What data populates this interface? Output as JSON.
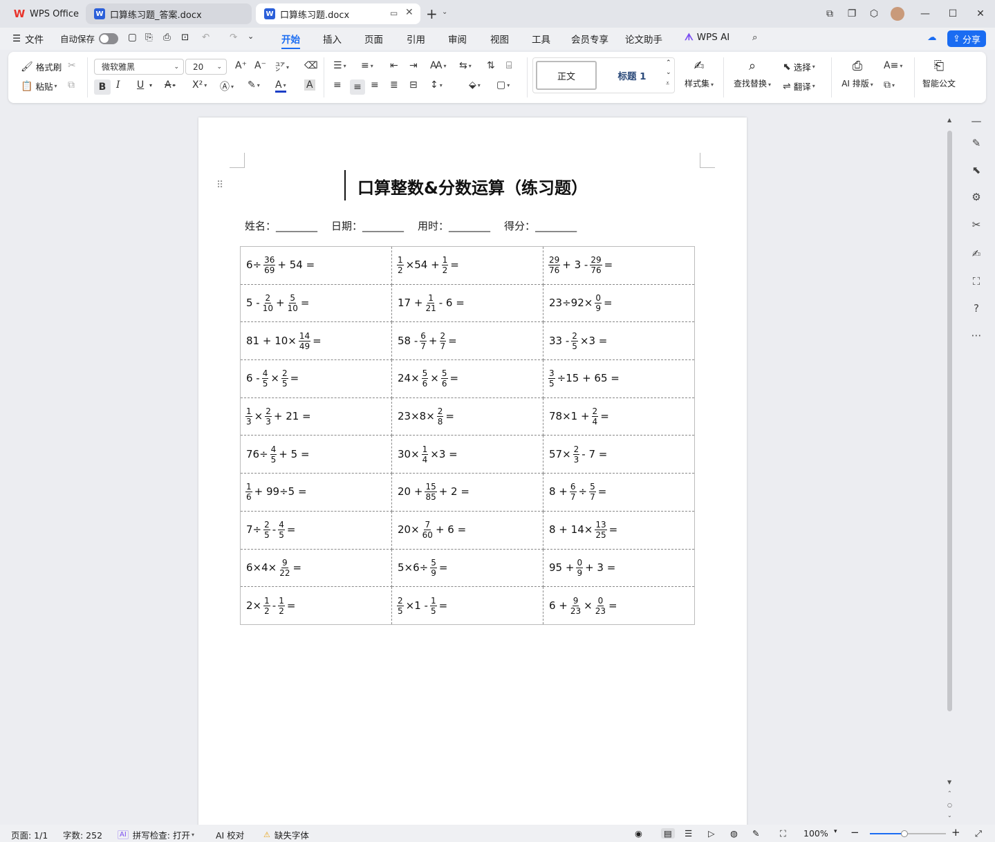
{
  "tabs": [
    {
      "label": "WPS Office"
    },
    {
      "label": "口算练习题_答案.docx"
    },
    {
      "label": "口算练习题.docx"
    }
  ],
  "menu": {
    "file": "文件",
    "autosave": "自动保存",
    "items": [
      "开始",
      "插入",
      "页面",
      "引用",
      "审阅",
      "视图",
      "工具",
      "会员专享",
      "论文助手",
      "WPS AI"
    ],
    "share": "分享"
  },
  "ribbon": {
    "format_painter": "格式刷",
    "paste": "粘贴",
    "font_name": "微软雅黑",
    "font_size": "20",
    "style_normal": "正文",
    "style_heading": "标题 1",
    "style_set": "样式集",
    "find_replace": "查找替换",
    "select": "选择",
    "translate": "翻译",
    "ai_layout": "AI 排版",
    "smart_doc": "智能公文",
    "bold": "B",
    "italic": "I",
    "underline": "U"
  },
  "document": {
    "title": "口算整数&分数运算（练习题）",
    "info": [
      {
        "label": "姓名：",
        "blank": "________"
      },
      {
        "label": "日期：",
        "blank": "________"
      },
      {
        "label": "用时：",
        "blank": "________"
      },
      {
        "label": "得分：",
        "blank": "________"
      }
    ],
    "problems": [
      [
        [
          {
            "t": "6÷"
          },
          {
            "n": "36",
            "d": "69"
          },
          {
            "t": "+ 54 ="
          }
        ],
        [
          {
            "n": "1",
            "d": "2"
          },
          {
            "t": "×54 +"
          },
          {
            "n": "1",
            "d": "2"
          },
          {
            "t": "="
          }
        ],
        [
          {
            "n": "29",
            "d": "76"
          },
          {
            "t": "+ 3 -"
          },
          {
            "n": "29",
            "d": "76"
          },
          {
            "t": "="
          }
        ]
      ],
      [
        [
          {
            "t": "5 -"
          },
          {
            "n": "2",
            "d": "10"
          },
          {
            "t": "+"
          },
          {
            "n": "5",
            "d": "10"
          },
          {
            "t": "="
          }
        ],
        [
          {
            "t": "17 +"
          },
          {
            "n": "1",
            "d": "21"
          },
          {
            "t": "- 6 ="
          }
        ],
        [
          {
            "t": "23÷92×"
          },
          {
            "n": "0",
            "d": "9"
          },
          {
            "t": "="
          }
        ]
      ],
      [
        [
          {
            "t": "81 + 10×"
          },
          {
            "n": "14",
            "d": "49"
          },
          {
            "t": "="
          }
        ],
        [
          {
            "t": "58 -"
          },
          {
            "n": "6",
            "d": "7"
          },
          {
            "t": "+"
          },
          {
            "n": "2",
            "d": "7"
          },
          {
            "t": "="
          }
        ],
        [
          {
            "t": "33 -"
          },
          {
            "n": "2",
            "d": "5"
          },
          {
            "t": "×3 ="
          }
        ]
      ],
      [
        [
          {
            "t": "6 -"
          },
          {
            "n": "4",
            "d": "5"
          },
          {
            "t": "×"
          },
          {
            "n": "2",
            "d": "5"
          },
          {
            "t": "="
          }
        ],
        [
          {
            "t": "24×"
          },
          {
            "n": "5",
            "d": "6"
          },
          {
            "t": "×"
          },
          {
            "n": "5",
            "d": "6"
          },
          {
            "t": "="
          }
        ],
        [
          {
            "n": "3",
            "d": "5"
          },
          {
            "t": "÷15 + 65 ="
          }
        ]
      ],
      [
        [
          {
            "n": "1",
            "d": "3"
          },
          {
            "t": "×"
          },
          {
            "n": "2",
            "d": "3"
          },
          {
            "t": "+ 21 ="
          }
        ],
        [
          {
            "t": "23×8×"
          },
          {
            "n": "2",
            "d": "8"
          },
          {
            "t": "="
          }
        ],
        [
          {
            "t": "78×1 +"
          },
          {
            "n": "2",
            "d": "4"
          },
          {
            "t": "="
          }
        ]
      ],
      [
        [
          {
            "t": "76÷"
          },
          {
            "n": "4",
            "d": "5"
          },
          {
            "t": "+ 5 ="
          }
        ],
        [
          {
            "t": "30×"
          },
          {
            "n": "1",
            "d": "4"
          },
          {
            "t": "×3 ="
          }
        ],
        [
          {
            "t": "57×"
          },
          {
            "n": "2",
            "d": "3"
          },
          {
            "t": "- 7 ="
          }
        ]
      ],
      [
        [
          {
            "n": "1",
            "d": "6"
          },
          {
            "t": "+ 99÷5 ="
          }
        ],
        [
          {
            "t": "20 +"
          },
          {
            "n": "15",
            "d": "85"
          },
          {
            "t": "+ 2 ="
          }
        ],
        [
          {
            "t": "8 +"
          },
          {
            "n": "6",
            "d": "7"
          },
          {
            "t": "÷"
          },
          {
            "n": "5",
            "d": "7"
          },
          {
            "t": "="
          }
        ]
      ],
      [
        [
          {
            "t": "7÷"
          },
          {
            "n": "2",
            "d": "5"
          },
          {
            "t": "-"
          },
          {
            "n": "4",
            "d": "5"
          },
          {
            "t": "="
          }
        ],
        [
          {
            "t": "20×"
          },
          {
            "n": "7",
            "d": "60"
          },
          {
            "t": "+ 6 ="
          }
        ],
        [
          {
            "t": "8 + 14×"
          },
          {
            "n": "13",
            "d": "25"
          },
          {
            "t": "="
          }
        ]
      ],
      [
        [
          {
            "t": "6×4×"
          },
          {
            "n": "9",
            "d": "22"
          },
          {
            "t": "="
          }
        ],
        [
          {
            "t": "5×6÷"
          },
          {
            "n": "5",
            "d": "9"
          },
          {
            "t": "="
          }
        ],
        [
          {
            "t": "95 +"
          },
          {
            "n": "0",
            "d": "9"
          },
          {
            "t": "+ 3 ="
          }
        ]
      ],
      [
        [
          {
            "t": "2×"
          },
          {
            "n": "1",
            "d": "2"
          },
          {
            "t": "-"
          },
          {
            "n": "1",
            "d": "2"
          },
          {
            "t": "="
          }
        ],
        [
          {
            "n": "2",
            "d": "5"
          },
          {
            "t": "×1 -"
          },
          {
            "n": "1",
            "d": "5"
          },
          {
            "t": "="
          }
        ],
        [
          {
            "t": "6 +"
          },
          {
            "n": "9",
            "d": "23"
          },
          {
            "t": "×"
          },
          {
            "n": "0",
            "d": "23"
          },
          {
            "t": "="
          }
        ]
      ]
    ]
  },
  "status": {
    "page": "页面: 1/1",
    "words": "字数: 252",
    "spell": "拼写检查: 打开",
    "ai_check": "AI 校对",
    "missing_font": "缺失字体",
    "zoom": "100%"
  },
  "colors": {
    "accent": "#1a6cf2",
    "wps_red": "#e8332a",
    "word_blue": "#2b5fd9",
    "ai_purple": "#7a4df2"
  },
  "zoom_level": 100
}
